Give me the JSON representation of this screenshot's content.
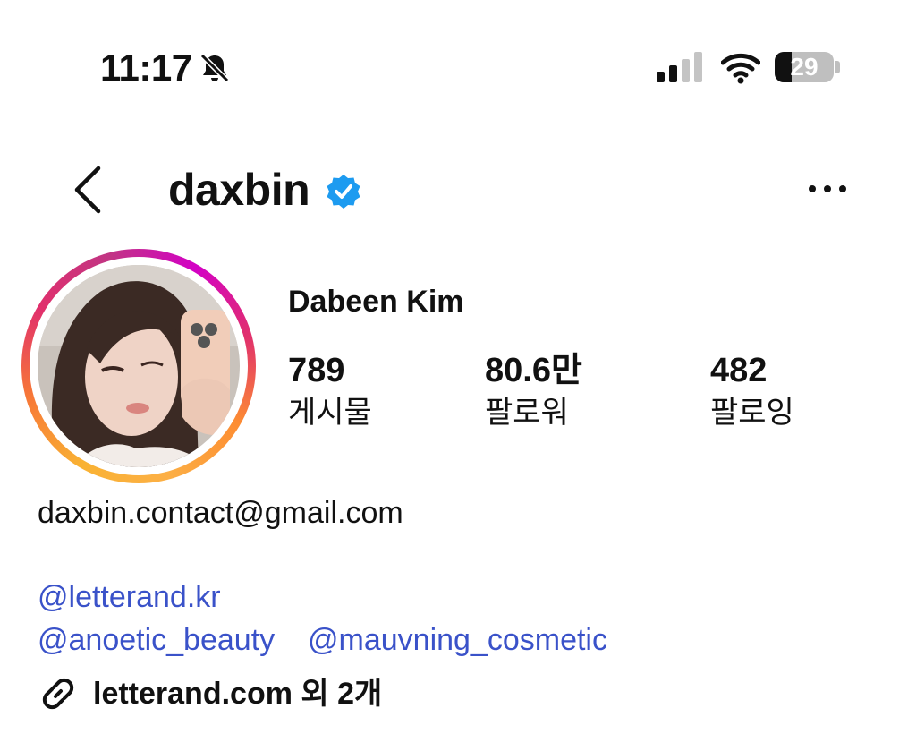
{
  "status_bar": {
    "time": "11:17",
    "battery_level": "29",
    "battery_fraction": 0.29
  },
  "header": {
    "username": "daxbin",
    "verified": true,
    "icons": {
      "back": "chevron-left-icon",
      "verified": "verified-badge-icon",
      "more": "more-horizontal-icon"
    }
  },
  "profile": {
    "full_name": "Dabeen Kim",
    "stats": [
      {
        "value": "789",
        "label": "게시물"
      },
      {
        "value": "80.6만",
        "label": "팔로워"
      },
      {
        "value": "482",
        "label": "팔로잉"
      }
    ]
  },
  "bio": {
    "email": "daxbin.contact@gmail.com",
    "mentions_line1": "@letterand.kr",
    "mentions_line2_a": "@anoetic_beauty",
    "mentions_line2_b": "@mauvning_cosmetic",
    "link_text": "letterand.com 외 2개"
  },
  "colors": {
    "verified_blue": "#1d9bf0",
    "mention_blue": "#3a52c9",
    "text": "#111111"
  }
}
